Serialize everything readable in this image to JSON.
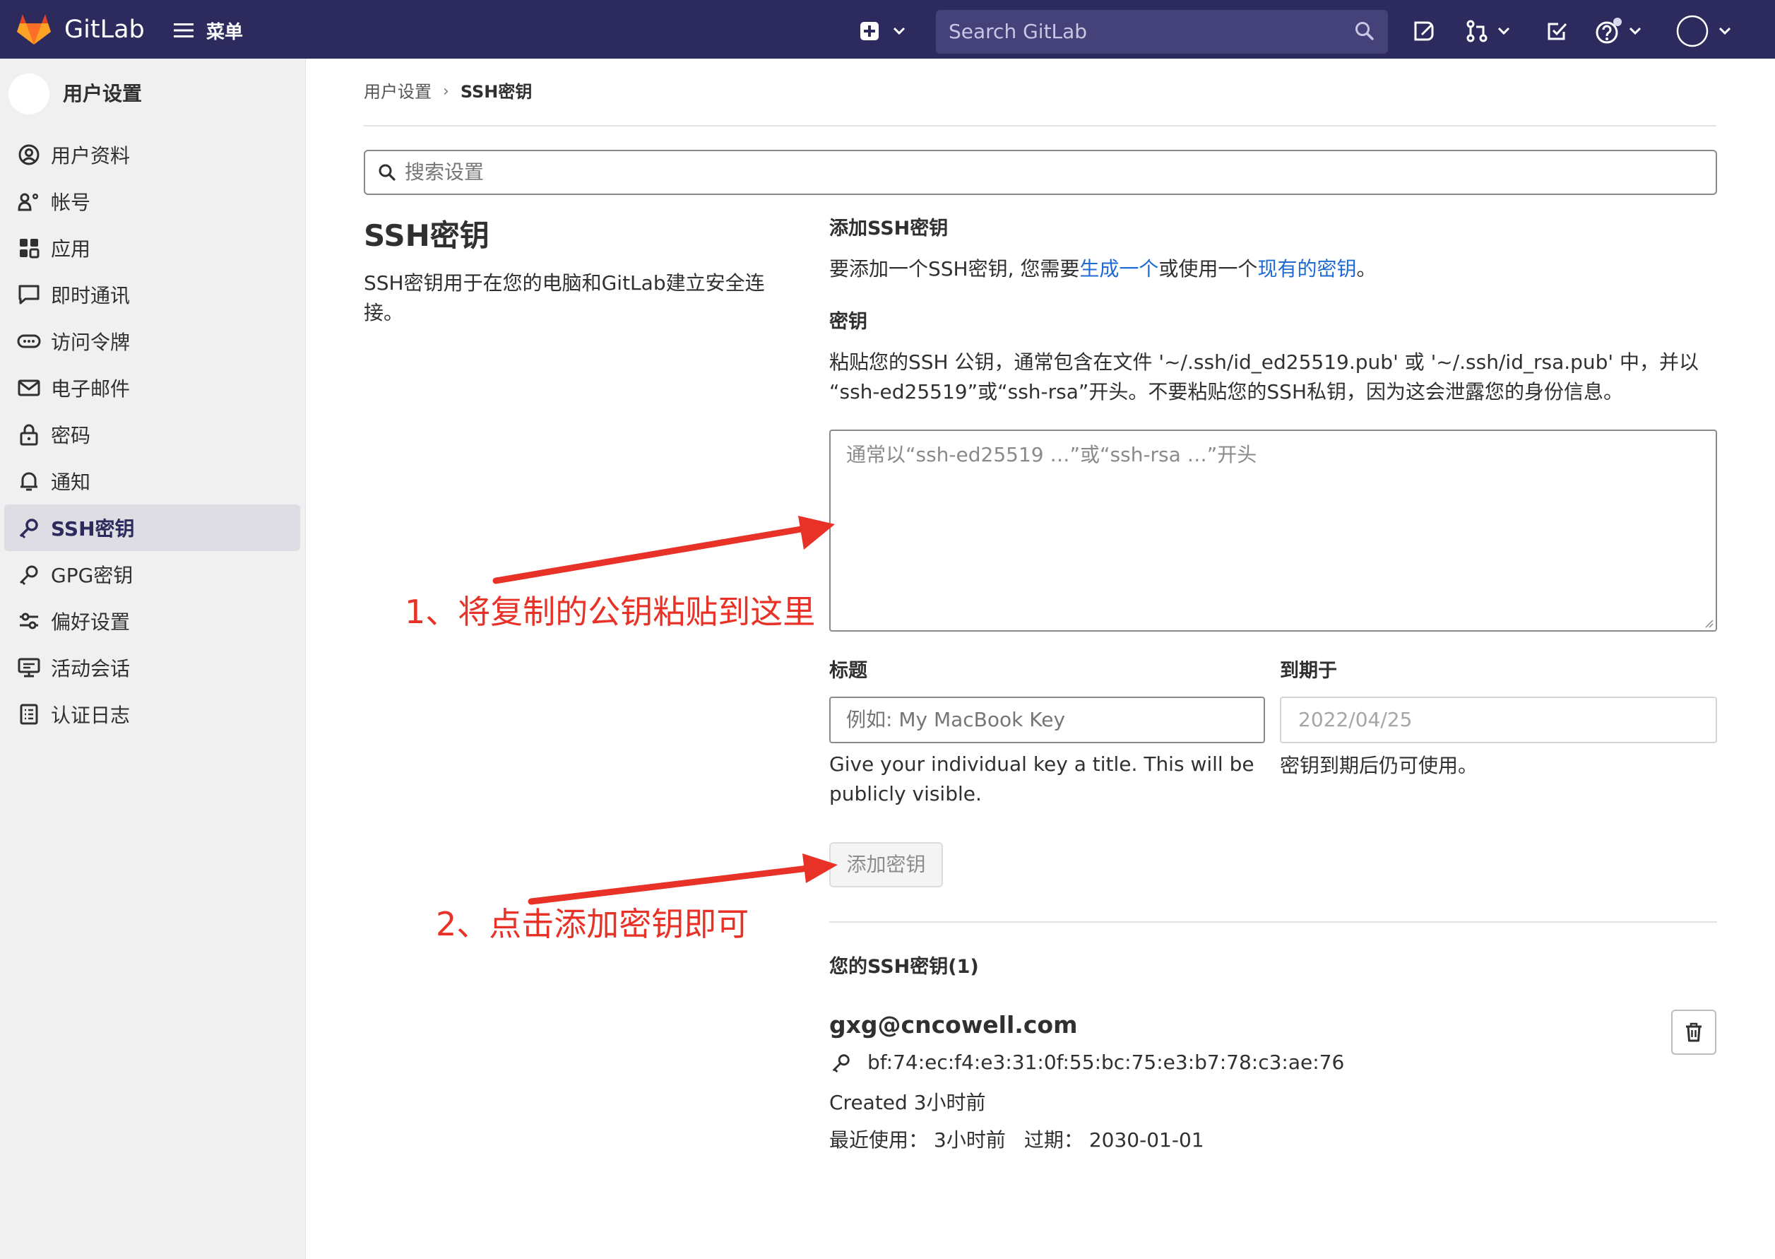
{
  "colors": {
    "navbar": "#2d2a5e",
    "link": "#1f6bd4",
    "annotation": "#e83227",
    "sidebar_active": "#dddde3"
  },
  "navbar": {
    "brand": "GitLab",
    "menu_label": "菜单",
    "search_placeholder": "Search GitLab",
    "icons": [
      "new-item-icon",
      "issues-icon",
      "merge-requests-icon",
      "todos-icon",
      "help-icon",
      "user-avatar-icon"
    ]
  },
  "sidebar": {
    "title": "用户设置",
    "items": [
      {
        "label": "用户资料",
        "icon": "profile-icon"
      },
      {
        "label": "帐号",
        "icon": "account-icon"
      },
      {
        "label": "应用",
        "icon": "applications-icon"
      },
      {
        "label": "即时通讯",
        "icon": "chat-icon"
      },
      {
        "label": "访问令牌",
        "icon": "token-icon"
      },
      {
        "label": "电子邮件",
        "icon": "mail-icon"
      },
      {
        "label": "密码",
        "icon": "lock-icon"
      },
      {
        "label": "通知",
        "icon": "bell-icon"
      },
      {
        "label": "SSH密钥",
        "icon": "key-icon",
        "active": true
      },
      {
        "label": "GPG密钥",
        "icon": "key-icon"
      },
      {
        "label": "偏好设置",
        "icon": "preferences-icon"
      },
      {
        "label": "活动会话",
        "icon": "monitor-icon"
      },
      {
        "label": "认证日志",
        "icon": "log-icon"
      }
    ]
  },
  "breadcrumb": {
    "parent": "用户设置",
    "separator": "›",
    "current": "SSH密钥"
  },
  "search_settings": {
    "placeholder": "搜索设置"
  },
  "section": {
    "title": "SSH密钥",
    "description": "SSH密钥用于在您的电脑和GitLab建立安全连接。"
  },
  "form": {
    "heading": "添加SSH密钥",
    "intro_prefix": "要添加一个SSH密钥, 您需要",
    "intro_link1": "生成一个",
    "intro_middle": "或使用一个",
    "intro_link2": "现有的密钥",
    "intro_suffix": "。",
    "key_label": "密钥",
    "key_help_line1": "粘贴您的SSH 公钥，通常包含在文件 '~/.ssh/id_ed25519.pub' 或 '~/.ssh/id_rsa.pub' 中，并以",
    "key_help_line2": "“ssh-ed25519”或“ssh-rsa”开头。不要粘贴您的SSH私钥，因为这会泄露您的身份信息。",
    "key_placeholder": "通常以“ssh-ed25519 …”或“ssh-rsa …”开头",
    "title_label": "标题",
    "title_placeholder": "例如: My MacBook Key",
    "title_help_line1": "Give your individual key a title. This will be",
    "title_help_line2": "publicly visible.",
    "expires_label": "到期于",
    "expires_value": "2022/04/25",
    "expires_help": "密钥到期后仍可使用。",
    "submit_label": "添加密钥"
  },
  "keys": {
    "heading": "您的SSH密钥(1)",
    "items": [
      {
        "title": "gxg@cncowell.com",
        "fingerprint": "bf:74:ec:f4:e3:31:0f:55:bc:75:e3:b7:78:c3:ae:76",
        "created": "Created 3小时前",
        "last_used_label": "最近使用：",
        "last_used_value": "3小时前",
        "expires_label": "过期：",
        "expires_value": "2030-01-01"
      }
    ]
  },
  "annotations": {
    "step1": "1、将复制的公钥粘贴到这里",
    "step2": "2、点击添加密钥即可"
  }
}
